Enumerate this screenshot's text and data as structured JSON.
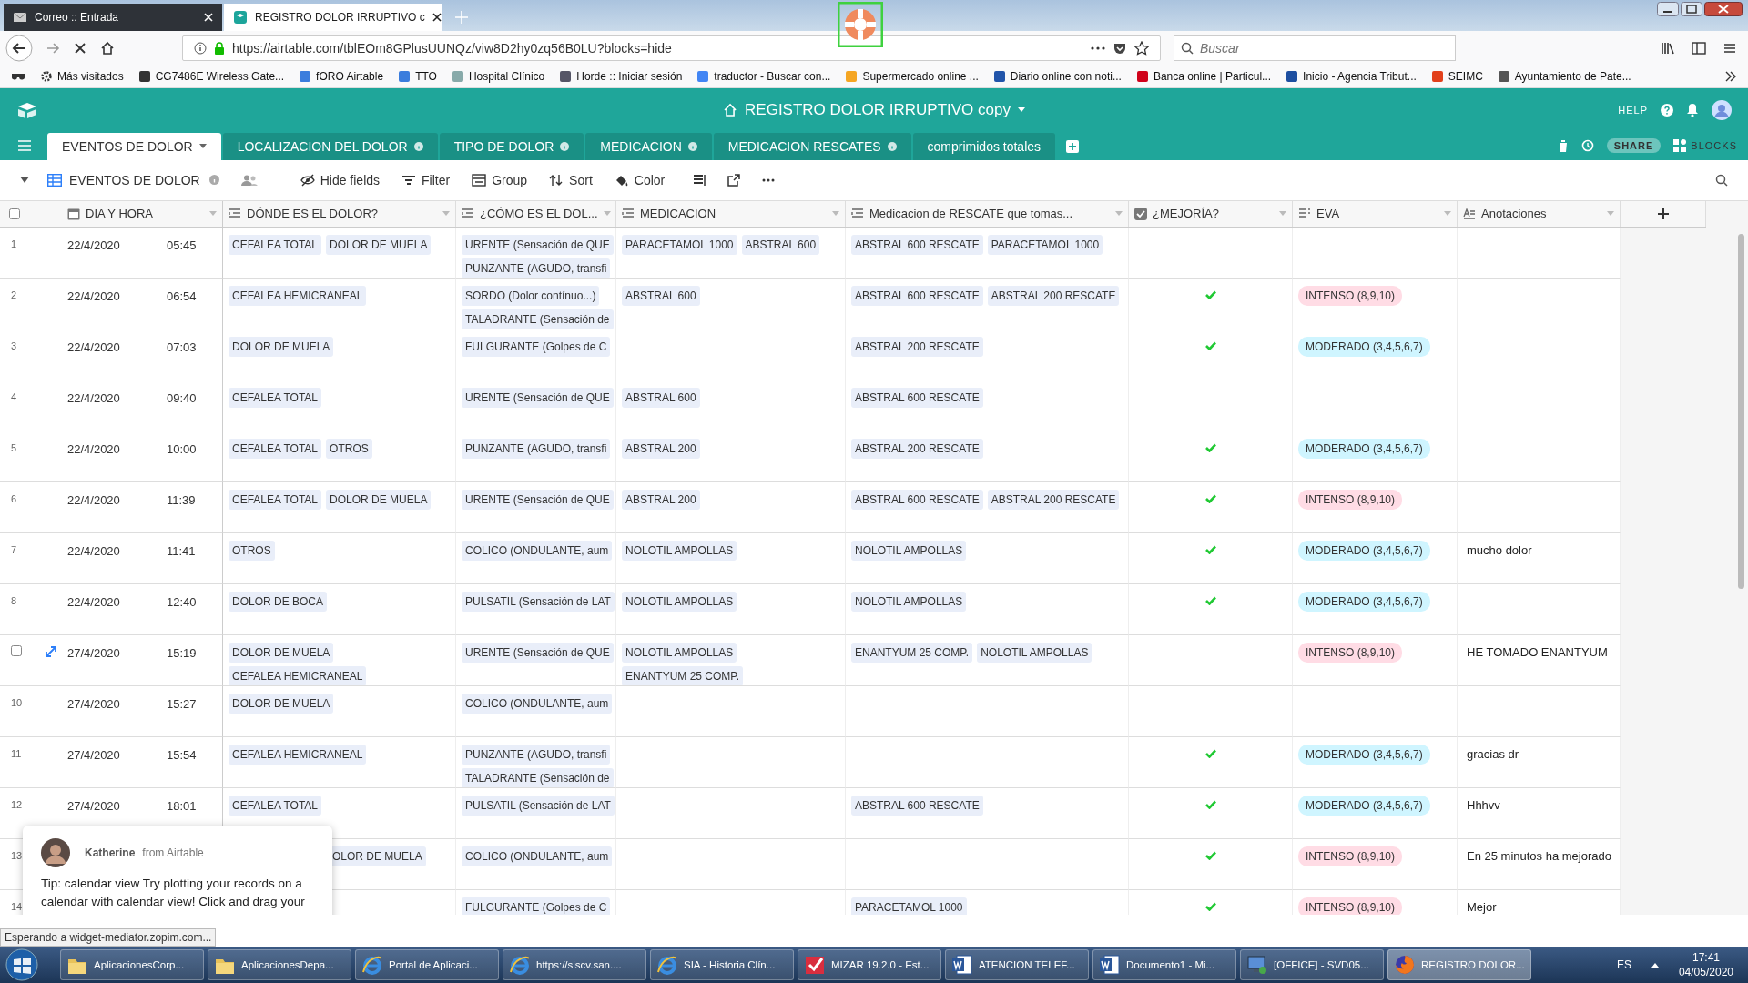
{
  "browser": {
    "tabs": [
      {
        "title": "Correo :: Entrada",
        "selected": false
      },
      {
        "title": "REGISTRO DOLOR IRRUPTIVO c",
        "selected": true
      }
    ],
    "url": "https://airtable.com/tblEOm8GPlusUUNQz/viw8D2hy0zq56B0LU?blocks=hide",
    "search_placeholder": "Buscar",
    "bookmarks": [
      "Más visitados",
      "CG7486E Wireless Gate...",
      "fORO Airtable",
      "TTO",
      "Hospital Clínico",
      "Horde :: Iniciar sesión",
      "traductor - Buscar con...",
      "Supermercado online ...",
      "Diario online con noti...",
      "Banca online | Particul...",
      "Inicio - Agencia Tribut...",
      "SEIMC",
      "Ayuntamiento de Pate..."
    ]
  },
  "app": {
    "title": "REGISTRO DOLOR IRRUPTIVO copy",
    "help": "HELP",
    "tables": [
      {
        "label": "EVENTOS DE DOLOR",
        "selected": true,
        "info": false
      },
      {
        "label": "LOCALIZACION DEL DOLOR",
        "selected": false,
        "info": true
      },
      {
        "label": "TIPO DE DOLOR",
        "selected": false,
        "info": true
      },
      {
        "label": "MEDICACION",
        "selected": false,
        "info": true
      },
      {
        "label": "MEDICACION RESCATES",
        "selected": false,
        "info": true
      },
      {
        "label": "comprimidos totales",
        "selected": false,
        "info": false
      }
    ],
    "share": "SHARE",
    "blocks": "BLOCKS"
  },
  "toolbar": {
    "view": "EVENTOS DE DOLOR",
    "buttons": [
      {
        "label": "Hide fields",
        "kind": "hide"
      },
      {
        "label": "Filter",
        "kind": "filter"
      },
      {
        "label": "Group",
        "kind": "group"
      },
      {
        "label": "Sort",
        "kind": "sort"
      },
      {
        "label": "Color",
        "kind": "color"
      }
    ]
  },
  "table": {
    "select_all": {
      "checked": false
    },
    "columns": [
      {
        "label": "DIA Y HORA",
        "kind": "date"
      },
      {
        "label": "DÓNDE ES EL DOLOR?",
        "kind": "multi"
      },
      {
        "label": "¿CÓMO ES EL DOL...",
        "kind": "multi"
      },
      {
        "label": "MEDICACION",
        "kind": "multi"
      },
      {
        "label": "Medicacion de RESCATE que tomas...",
        "kind": "multi"
      },
      {
        "label": "¿MEJORÍA?",
        "kind": "checkbox"
      },
      {
        "label": "EVA",
        "kind": "select"
      },
      {
        "label": "Anotaciones",
        "kind": "text"
      }
    ],
    "rows": [
      {
        "number": "1",
        "hovered": false,
        "date": "22/4/2020",
        "time": "05:45",
        "donde": [
          "CEFALEA TOTAL",
          "DOLOR DE MUELA"
        ],
        "como": [
          "URENTE (Sensación de QUE",
          "PUNZANTE (AGUDO, transfi"
        ],
        "medicacion": [
          "PARACETAMOL 1000",
          "ABSTRAL 600"
        ],
        "rescate": [
          "ABSTRAL 600 RESCATE",
          "PARACETAMOL 1000"
        ],
        "mejoria": false
      },
      {
        "number": "2",
        "hovered": false,
        "date": "22/4/2020",
        "time": "06:54",
        "donde": [
          "CEFALEA HEMICRANEAL"
        ],
        "como": [
          "SORDO (Dolor contínuo...)",
          "TALADRANTE (Sensación de"
        ],
        "medicacion": [
          "ABSTRAL 600"
        ],
        "rescate": [
          "ABSTRAL 600 RESCATE",
          "ABSTRAL 200 RESCATE"
        ],
        "mejoria": true,
        "eva": {
          "label": "INTENSO (8,9,10)",
          "color": "#ffdce5"
        }
      },
      {
        "number": "3",
        "hovered": false,
        "date": "22/4/2020",
        "time": "07:03",
        "donde": [
          "DOLOR DE MUELA"
        ],
        "como": [
          "FULGURANTE (Golpes de C"
        ],
        "rescate": [
          "ABSTRAL 200 RESCATE"
        ],
        "mejoria": true,
        "eva": {
          "label": "MODERADO (3,4,5,6,7)",
          "color": "#cff5ff"
        }
      },
      {
        "number": "4",
        "hovered": false,
        "date": "22/4/2020",
        "time": "09:40",
        "donde": [
          "CEFALEA TOTAL"
        ],
        "como": [
          "URENTE (Sensación de QUE"
        ],
        "medicacion": [
          "ABSTRAL 600"
        ],
        "rescate": [
          "ABSTRAL 600 RESCATE"
        ],
        "mejoria": false
      },
      {
        "number": "5",
        "hovered": false,
        "date": "22/4/2020",
        "time": "10:00",
        "donde": [
          "CEFALEA TOTAL",
          "OTROS"
        ],
        "como": [
          "PUNZANTE (AGUDO, transfi"
        ],
        "medicacion": [
          "ABSTRAL 200"
        ],
        "rescate": [
          "ABSTRAL 200 RESCATE"
        ],
        "mejoria": true,
        "eva": {
          "label": "MODERADO (3,4,5,6,7)",
          "color": "#cff5ff"
        }
      },
      {
        "number": "6",
        "hovered": false,
        "date": "22/4/2020",
        "time": "11:39",
        "donde": [
          "CEFALEA TOTAL",
          "DOLOR DE MUELA"
        ],
        "como": [
          "URENTE (Sensación de QUE"
        ],
        "medicacion": [
          "ABSTRAL 200"
        ],
        "rescate": [
          "ABSTRAL 600 RESCATE",
          "ABSTRAL 200 RESCATE"
        ],
        "mejoria": true,
        "eva": {
          "label": "INTENSO (8,9,10)",
          "color": "#ffdce5"
        }
      },
      {
        "number": "7",
        "hovered": false,
        "date": "22/4/2020",
        "time": "11:41",
        "donde": [
          "OTROS"
        ],
        "como": [
          "COLICO (ONDULANTE, aum"
        ],
        "medicacion": [
          "NOLOTIL AMPOLLAS"
        ],
        "rescate": [
          "NOLOTIL AMPOLLAS"
        ],
        "mejoria": true,
        "eva": {
          "label": "MODERADO (3,4,5,6,7)",
          "color": "#cff5ff"
        },
        "anotaciones": "mucho dolor"
      },
      {
        "number": "8",
        "hovered": false,
        "date": "22/4/2020",
        "time": "12:40",
        "donde": [
          "DOLOR DE BOCA"
        ],
        "como": [
          "PULSATIL (Sensación de LAT"
        ],
        "medicacion": [
          "NOLOTIL AMPOLLAS"
        ],
        "rescate": [
          "NOLOTIL AMPOLLAS"
        ],
        "mejoria": true,
        "eva": {
          "label": "MODERADO (3,4,5,6,7)",
          "color": "#cff5ff"
        }
      },
      {
        "hovered": true,
        "date": "27/4/2020",
        "time": "15:19",
        "donde": [
          "DOLOR DE MUELA",
          "CEFALEA HEMICRANEAL"
        ],
        "como": [
          "URENTE (Sensación de QUE"
        ],
        "medicacion": [
          "NOLOTIL AMPOLLAS",
          "ENANTYUM 25 COMP."
        ],
        "rescate": [
          "ENANTYUM 25 COMP.",
          "NOLOTIL AMPOLLAS"
        ],
        "mejoria": false,
        "eva": {
          "label": "INTENSO (8,9,10)",
          "color": "#ffdce5"
        },
        "anotaciones": "HE TOMADO ENANTYUM"
      },
      {
        "number": "10",
        "hovered": false,
        "date": "27/4/2020",
        "time": "15:27",
        "donde": [
          "DOLOR DE MUELA"
        ],
        "como": [
          "COLICO (ONDULANTE, aum"
        ],
        "mejoria": false
      },
      {
        "number": "11",
        "hovered": false,
        "date": "27/4/2020",
        "time": "15:54",
        "donde": [
          "CEFALEA HEMICRANEAL"
        ],
        "como": [
          "PUNZANTE (AGUDO, transfi",
          "TALADRANTE (Sensación de"
        ],
        "mejoria": true,
        "eva": {
          "label": "MODERADO (3,4,5,6,7)",
          "color": "#cff5ff"
        },
        "anotaciones": "gracias dr"
      },
      {
        "number": "12",
        "hovered": false,
        "date": "27/4/2020",
        "time": "18:01",
        "donde": [
          "CEFALEA TOTAL"
        ],
        "como": [
          "PULSATIL (Sensación de LAT"
        ],
        "rescate": [
          "ABSTRAL 600 RESCATE"
        ],
        "mejoria": true,
        "eva": {
          "label": "MODERADO (3,4,5,6,7)",
          "color": "#cff5ff"
        },
        "anotaciones": "Hhhvv"
      },
      {
        "number": "13",
        "hovered": false,
        "donde": [
          "OLOR DE MUELA"
        ],
        "donde_covered": true,
        "como": [
          "COLICO (ONDULANTE, aum"
        ],
        "mejoria": true,
        "eva": {
          "label": "INTENSO (8,9,10)",
          "color": "#ffdce5"
        },
        "anotaciones": "En 25 minutos ha mejorado"
      },
      {
        "number": "14",
        "hovered": false,
        "como": [
          "FULGURANTE (Golpes de C"
        ],
        "rescate": [
          "PARACETAMOL 1000"
        ],
        "mejoria": true,
        "eva": {
          "label": "INTENSO (8,9,10)",
          "color": "#ffdce5"
        },
        "anotaciones": "Mejor"
      }
    ]
  },
  "chat": {
    "agent": "Katherine",
    "from": "from Airtable",
    "message": "Tip: calendar view Try plotting your records on a calendar with calendar view! Click and drag your"
  },
  "status": "Esperando a widget-mediator.zopim.com...",
  "taskbar": {
    "items": [
      {
        "label": "AplicacionesCorp...",
        "kind": "folder",
        "selected": false
      },
      {
        "label": "AplicacionesDepa...",
        "kind": "folder",
        "selected": false
      },
      {
        "label": "Portal de Aplicaci...",
        "kind": "ie",
        "selected": false
      },
      {
        "label": "https://siscv.san....",
        "kind": "ie",
        "selected": false
      },
      {
        "label": "SIA - Historia Clín...",
        "kind": "ie",
        "selected": false
      },
      {
        "label": "MIZAR 19.2.0 - Est...",
        "kind": "mizar",
        "selected": false
      },
      {
        "label": "ATENCION TELEF...",
        "kind": "word",
        "selected": false
      },
      {
        "label": "Documento1 - Mi...",
        "kind": "word",
        "selected": false
      },
      {
        "label": "[OFFICE] - SVD05...",
        "kind": "remote",
        "selected": false
      },
      {
        "label": "REGISTRO DOLOR...",
        "kind": "firefox",
        "selected": true
      }
    ],
    "language": "ES",
    "time": "17:41",
    "date": "04/05/2020"
  }
}
